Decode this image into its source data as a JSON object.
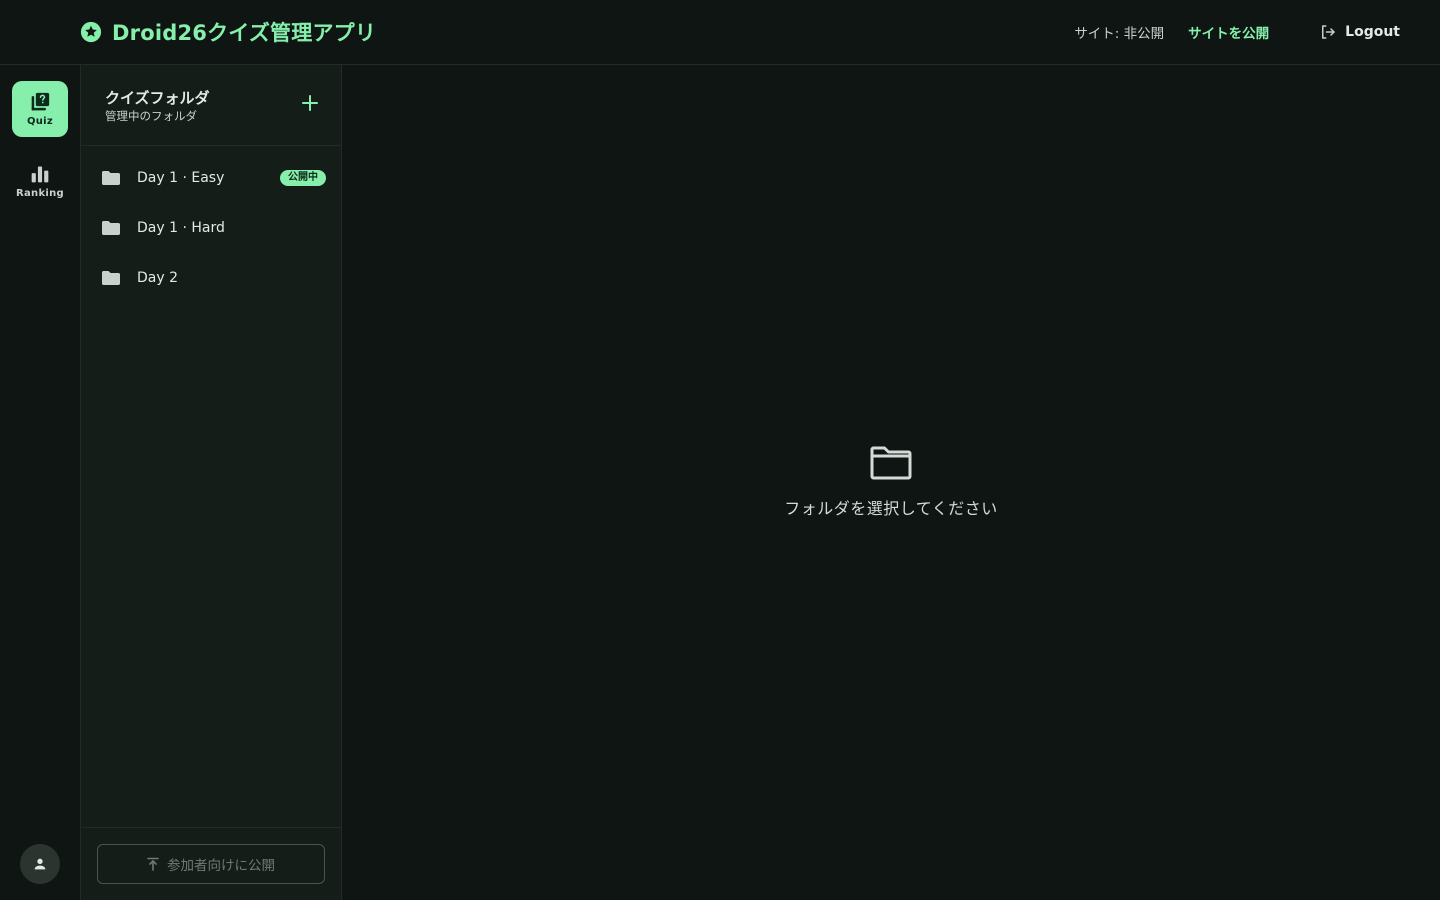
{
  "header": {
    "brand_icon": "star-badge-icon",
    "app_title": "Droid26クイズ管理アプリ",
    "site_status": "サイト: 非公開",
    "publish_site_label": "サイトを公開",
    "logout_label": "Logout"
  },
  "rail": {
    "items": [
      {
        "label": "Quiz",
        "icon": "quiz-icon",
        "active": true
      },
      {
        "label": "Ranking",
        "icon": "ranking-icon",
        "active": false
      }
    ],
    "avatar_icon": "person-icon"
  },
  "panel": {
    "title": "クイズフォルダ",
    "subtitle": "管理中のフォルダ",
    "folders": [
      {
        "name": "Day 1 · Easy",
        "badge": "公開中"
      },
      {
        "name": "Day 1 · Hard",
        "badge": ""
      },
      {
        "name": "Day 2",
        "badge": ""
      }
    ],
    "publish_button_label": "参加者向けに公開"
  },
  "main": {
    "empty_message": "フォルダを選択してください"
  },
  "colors": {
    "accent": "#86efac",
    "background": "#0e1512",
    "panel": "#151d19"
  }
}
